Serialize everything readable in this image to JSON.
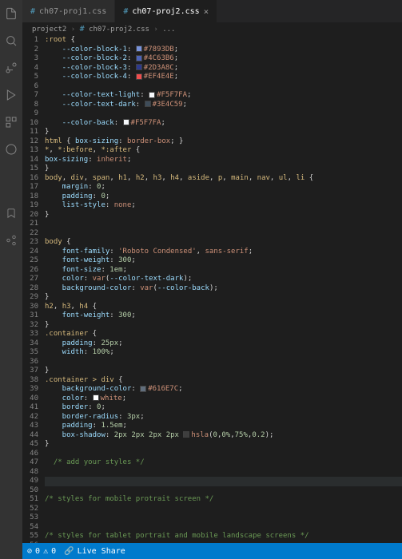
{
  "tabs": [
    {
      "label": "ch07-proj1.css",
      "active": false
    },
    {
      "label": "ch07-proj2.css",
      "active": true
    }
  ],
  "breadcrumb": {
    "parts": [
      "project2",
      "ch07-proj2.css",
      "..."
    ]
  },
  "code_lines": [
    [
      [
        "sel",
        ":root"
      ],
      [
        "punc",
        " {"
      ]
    ],
    [
      [
        "prop",
        "    --color-block-1"
      ],
      [
        "punc",
        ": "
      ],
      [
        "swatch",
        "#7893DB"
      ],
      [
        "val",
        "#7893DB"
      ],
      [
        "punc",
        ";"
      ]
    ],
    [
      [
        "prop",
        "    --color-block-2"
      ],
      [
        "punc",
        ": "
      ],
      [
        "swatch",
        "#4C63B6"
      ],
      [
        "val",
        "#4C63B6"
      ],
      [
        "punc",
        ";"
      ]
    ],
    [
      [
        "prop",
        "    --color-block-3"
      ],
      [
        "punc",
        ": "
      ],
      [
        "swatch",
        "#2D3A8C"
      ],
      [
        "val",
        "#2D3A8C"
      ],
      [
        "punc",
        ";"
      ]
    ],
    [
      [
        "prop",
        "    --color-block-4"
      ],
      [
        "punc",
        ": "
      ],
      [
        "swatch",
        "#EF4E4E"
      ],
      [
        "val",
        "#EF4E4E"
      ],
      [
        "punc",
        ";"
      ]
    ],
    [],
    [
      [
        "prop",
        "    --color-text-light"
      ],
      [
        "punc",
        ": "
      ],
      [
        "swatch",
        "#F5F7FA"
      ],
      [
        "val",
        "#F5F7FA"
      ],
      [
        "punc",
        ";"
      ]
    ],
    [
      [
        "prop",
        "    --color-text-dark"
      ],
      [
        "punc",
        ": "
      ],
      [
        "swatch",
        "#3E4C59"
      ],
      [
        "val",
        "#3E4C59"
      ],
      [
        "punc",
        ";"
      ]
    ],
    [],
    [
      [
        "prop",
        "    --color-back"
      ],
      [
        "punc",
        ": "
      ],
      [
        "swatch",
        "#F5F7FA"
      ],
      [
        "val",
        "#F5F7FA"
      ],
      [
        "punc",
        ";"
      ]
    ],
    [
      [
        "punc",
        "}"
      ]
    ],
    [
      [
        "sel",
        "html"
      ],
      [
        "punc",
        " { "
      ],
      [
        "prop",
        "box-sizing"
      ],
      [
        "punc",
        ": "
      ],
      [
        "val",
        "border-box"
      ],
      [
        "punc",
        "; }"
      ]
    ],
    [
      [
        "sel",
        "*"
      ],
      [
        "punc",
        ", "
      ],
      [
        "sel",
        "*:before"
      ],
      [
        "punc",
        ", "
      ],
      [
        "sel",
        "*:after"
      ],
      [
        "punc",
        " {"
      ]
    ],
    [
      [
        "prop",
        "box-sizing"
      ],
      [
        "punc",
        ": "
      ],
      [
        "val",
        "inherit"
      ],
      [
        "punc",
        ";"
      ]
    ],
    [
      [
        "punc",
        "}"
      ]
    ],
    [
      [
        "sel",
        "body"
      ],
      [
        "punc",
        ", "
      ],
      [
        "sel",
        "div"
      ],
      [
        "punc",
        ", "
      ],
      [
        "sel",
        "span"
      ],
      [
        "punc",
        ", "
      ],
      [
        "sel",
        "h1"
      ],
      [
        "punc",
        ", "
      ],
      [
        "sel",
        "h2"
      ],
      [
        "punc",
        ", "
      ],
      [
        "sel",
        "h3"
      ],
      [
        "punc",
        ", "
      ],
      [
        "sel",
        "h4"
      ],
      [
        "punc",
        ", "
      ],
      [
        "sel",
        "aside"
      ],
      [
        "punc",
        ", "
      ],
      [
        "sel",
        "p"
      ],
      [
        "punc",
        ", "
      ],
      [
        "sel",
        "main"
      ],
      [
        "punc",
        ", "
      ],
      [
        "sel",
        "nav"
      ],
      [
        "punc",
        ", "
      ],
      [
        "sel",
        "ul"
      ],
      [
        "punc",
        ", "
      ],
      [
        "sel",
        "li"
      ],
      [
        "punc",
        " {"
      ]
    ],
    [
      [
        "prop",
        "    margin"
      ],
      [
        "punc",
        ": "
      ],
      [
        "num",
        "0"
      ],
      [
        "punc",
        ";"
      ]
    ],
    [
      [
        "prop",
        "    padding"
      ],
      [
        "punc",
        ": "
      ],
      [
        "num",
        "0"
      ],
      [
        "punc",
        ";"
      ]
    ],
    [
      [
        "prop",
        "    list-style"
      ],
      [
        "punc",
        ": "
      ],
      [
        "val",
        "none"
      ],
      [
        "punc",
        ";"
      ]
    ],
    [
      [
        "punc",
        "}"
      ]
    ],
    [],
    [],
    [
      [
        "sel",
        "body"
      ],
      [
        "punc",
        " {"
      ]
    ],
    [
      [
        "prop",
        "    font-family"
      ],
      [
        "punc",
        ": "
      ],
      [
        "val",
        "'Roboto Condensed'"
      ],
      [
        "punc",
        ", "
      ],
      [
        "val",
        "sans-serif"
      ],
      [
        "punc",
        ";"
      ]
    ],
    [
      [
        "prop",
        "    font-weight"
      ],
      [
        "punc",
        ": "
      ],
      [
        "num",
        "300"
      ],
      [
        "punc",
        ";"
      ]
    ],
    [
      [
        "prop",
        "    font-size"
      ],
      [
        "punc",
        ": "
      ],
      [
        "num",
        "1em"
      ],
      [
        "punc",
        ";"
      ]
    ],
    [
      [
        "prop",
        "    color"
      ],
      [
        "punc",
        ": "
      ],
      [
        "val",
        "var"
      ],
      [
        "punc",
        "("
      ],
      [
        "prop",
        "--color-text-dark"
      ],
      [
        "punc",
        ");"
      ]
    ],
    [
      [
        "prop",
        "    background-color"
      ],
      [
        "punc",
        ": "
      ],
      [
        "val",
        "var"
      ],
      [
        "punc",
        "("
      ],
      [
        "prop",
        "--color-back"
      ],
      [
        "punc",
        ");"
      ]
    ],
    [
      [
        "punc",
        "}"
      ]
    ],
    [
      [
        "sel",
        "h2"
      ],
      [
        "punc",
        ", "
      ],
      [
        "sel",
        "h3"
      ],
      [
        "punc",
        ", "
      ],
      [
        "sel",
        "h4"
      ],
      [
        "punc",
        " {"
      ]
    ],
    [
      [
        "prop",
        "    font-weight"
      ],
      [
        "punc",
        ": "
      ],
      [
        "num",
        "300"
      ],
      [
        "punc",
        ";"
      ]
    ],
    [
      [
        "punc",
        "}"
      ]
    ],
    [
      [
        "sel",
        ".container"
      ],
      [
        "punc",
        " {"
      ]
    ],
    [
      [
        "prop",
        "    padding"
      ],
      [
        "punc",
        ": "
      ],
      [
        "num",
        "25px"
      ],
      [
        "punc",
        ";"
      ]
    ],
    [
      [
        "prop",
        "    width"
      ],
      [
        "punc",
        ": "
      ],
      [
        "num",
        "100%"
      ],
      [
        "punc",
        ";"
      ]
    ],
    [],
    [
      [
        "punc",
        "}"
      ]
    ],
    [
      [
        "sel",
        ".container > div"
      ],
      [
        "punc",
        " {"
      ]
    ],
    [
      [
        "prop",
        "    background-color"
      ],
      [
        "punc",
        ": "
      ],
      [
        "swatch",
        "#616E7C"
      ],
      [
        "val",
        "#616E7C"
      ],
      [
        "punc",
        ";"
      ]
    ],
    [
      [
        "prop",
        "    color"
      ],
      [
        "punc",
        ": "
      ],
      [
        "swatch",
        "#FFFFFF"
      ],
      [
        "val",
        "white"
      ],
      [
        "punc",
        ";"
      ]
    ],
    [
      [
        "prop",
        "    border"
      ],
      [
        "punc",
        ": "
      ],
      [
        "num",
        "0"
      ],
      [
        "punc",
        ";"
      ]
    ],
    [
      [
        "prop",
        "    border-radius"
      ],
      [
        "punc",
        ": "
      ],
      [
        "num",
        "3px"
      ],
      [
        "punc",
        ";"
      ]
    ],
    [
      [
        "prop",
        "    padding"
      ],
      [
        "punc",
        ": "
      ],
      [
        "num",
        "1.5em"
      ],
      [
        "punc",
        ";"
      ]
    ],
    [
      [
        "prop",
        "    box-shadow"
      ],
      [
        "punc",
        ": "
      ],
      [
        "num",
        "2px 2px 2px 2px "
      ],
      [
        "swatch",
        "hsla(0,0%,75%,0.2)"
      ],
      [
        "val",
        "hsla"
      ],
      [
        "punc",
        "("
      ],
      [
        "num",
        "0"
      ],
      [
        "punc",
        ","
      ],
      [
        "num",
        "0%"
      ],
      [
        "punc",
        ","
      ],
      [
        "num",
        "75%"
      ],
      [
        "punc",
        ","
      ],
      [
        "num",
        "0.2"
      ],
      [
        "punc",
        ");"
      ]
    ],
    [
      [
        "punc",
        "}"
      ]
    ],
    [],
    [
      [
        "comment",
        "  /* add your styles */"
      ]
    ],
    [],
    [],
    [],
    [
      [
        "comment",
        "/* styles for mobile protrait screen */"
      ]
    ],
    [],
    [],
    [],
    [
      [
        "comment",
        "/* styles for tablet portrait and mobile landscape screens */"
      ]
    ],
    []
  ],
  "cursor_line": 49,
  "statusbar": {
    "errors": "0",
    "warnings": "0",
    "live_share": "Live Share"
  }
}
